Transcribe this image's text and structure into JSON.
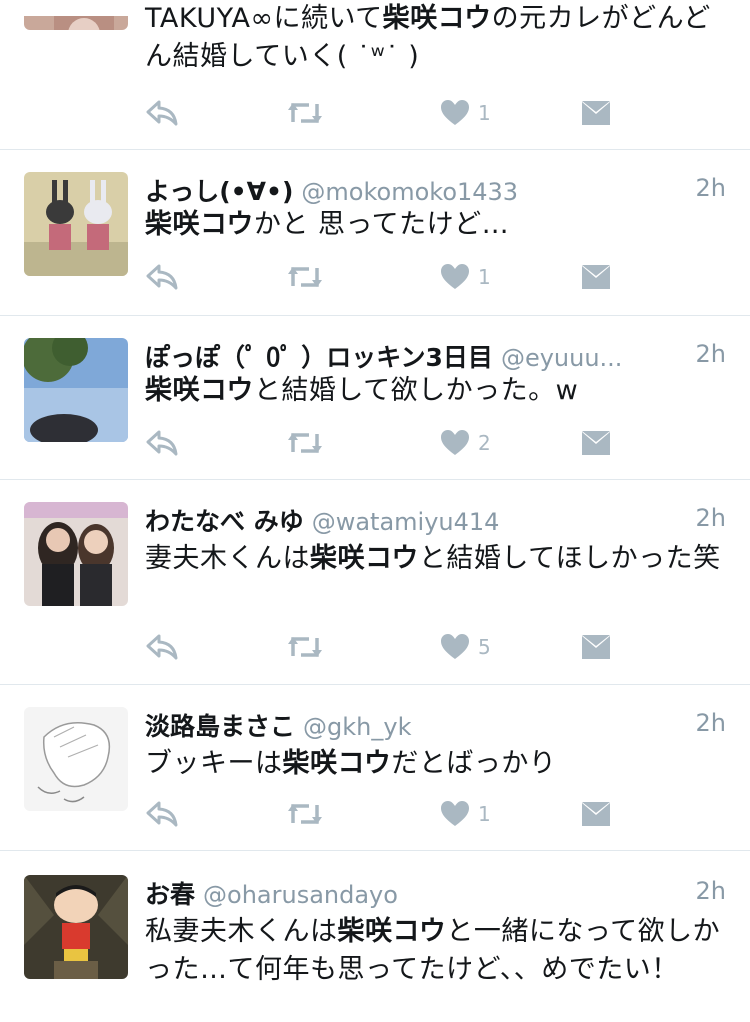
{
  "colors": {
    "name": "#14171a",
    "secondary": "#8899a6",
    "icon": "#aab8c2",
    "divider": "#e1e8ed"
  },
  "tweets": [
    {
      "name": "",
      "handle": "",
      "time": "",
      "text_before": "TAKUYA∞に続いて",
      "keyword": "柴咲コウ",
      "text_after": "の元カレがどんどん結婚していく( ˙ʷ˙ )",
      "likes": "1"
    },
    {
      "name": "よっし(•∀•)",
      "handle": "@mokomoko1433",
      "time": "2h",
      "text_before": "",
      "keyword": "柴咲コウ",
      "text_after": "かと 思ってたけど…",
      "likes": "1"
    },
    {
      "name": "ぽっぽ（ﾟ 0ﾟ ）ロッキン3日目",
      "handle": "@eyuuu...",
      "time": "2h",
      "text_before": "",
      "keyword": "柴咲コウ",
      "text_after": "と結婚して欲しかった。w",
      "likes": "2"
    },
    {
      "name": "わたなべ みゆ",
      "handle": "@watamiyu414",
      "time": "2h",
      "text_before": "妻夫木くんは",
      "keyword": "柴咲コウ",
      "text_after": "と結婚してほしかった笑",
      "likes": "5"
    },
    {
      "name": "淡路島まさこ",
      "handle": "@gkh_yk",
      "time": "2h",
      "text_before": "ブッキーは",
      "keyword": "柴咲コウ",
      "text_after": "だとばっかり",
      "likes": "1"
    },
    {
      "name": "お春",
      "handle": "@oharusandayo",
      "time": "2h",
      "text_before": "私妻夫木くんは",
      "keyword": "柴咲コウ",
      "text_after": "と一緒になって欲しかった…て何年も思ってたけど、、めでたい！",
      "likes": ""
    }
  ],
  "icons": {
    "reply": "reply-icon",
    "retweet": "retweet-icon",
    "like": "heart-icon",
    "dm": "envelope-icon"
  }
}
